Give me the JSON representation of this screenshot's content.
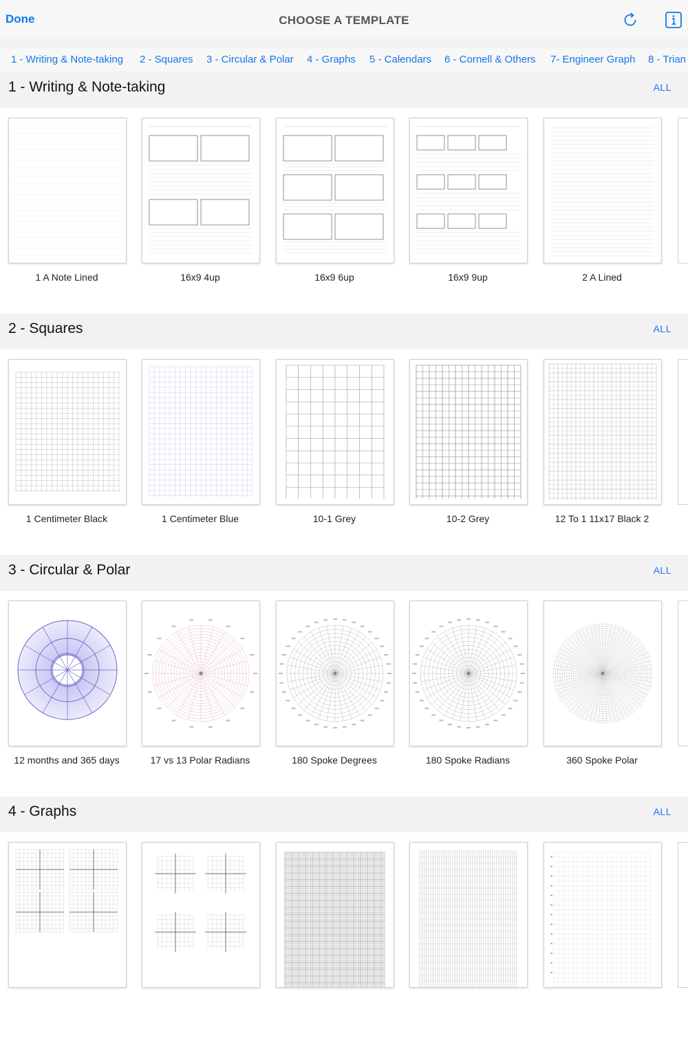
{
  "header": {
    "done_label": "Done",
    "title": "CHOOSE A TEMPLATE",
    "refresh_icon": "refresh-icon",
    "info_icon": "info-icon"
  },
  "tabs": [
    "1 - Writing & Note-taking",
    "2 - Squares",
    "3 - Circular & Polar",
    "4 - Graphs",
    "5 - Calendars",
    "6 - Cornell & Others",
    "7- Engineer Graph",
    "8 - Trian"
  ],
  "sections": [
    {
      "title": "1 - Writing & Note-taking",
      "all_label": "ALL",
      "templates": [
        "1 A Note Lined",
        "16x9 4up",
        "16x9 6up",
        "16x9 9up",
        "2 A Lined"
      ]
    },
    {
      "title": "2 - Squares",
      "all_label": "ALL",
      "templates": [
        "1 Centimeter Black",
        "1 Centimeter Blue",
        "10-1 Grey",
        "10-2 Grey",
        "12 To 1 11x17 Black 2"
      ]
    },
    {
      "title": "3 - Circular & Polar",
      "all_label": "ALL",
      "templates": [
        "12 months and 365 days",
        "17 vs 13 Polar Radians",
        "180 Spoke Degrees",
        "180 Spoke Radians",
        "360 Spoke Polar"
      ]
    },
    {
      "title": "4 - Graphs",
      "all_label": "ALL",
      "templates": [
        "",
        "",
        "",
        "",
        ""
      ]
    }
  ],
  "colors": {
    "accent": "#1577e8",
    "background": "#f2f2f2",
    "card_border": "#cfcfcf"
  }
}
